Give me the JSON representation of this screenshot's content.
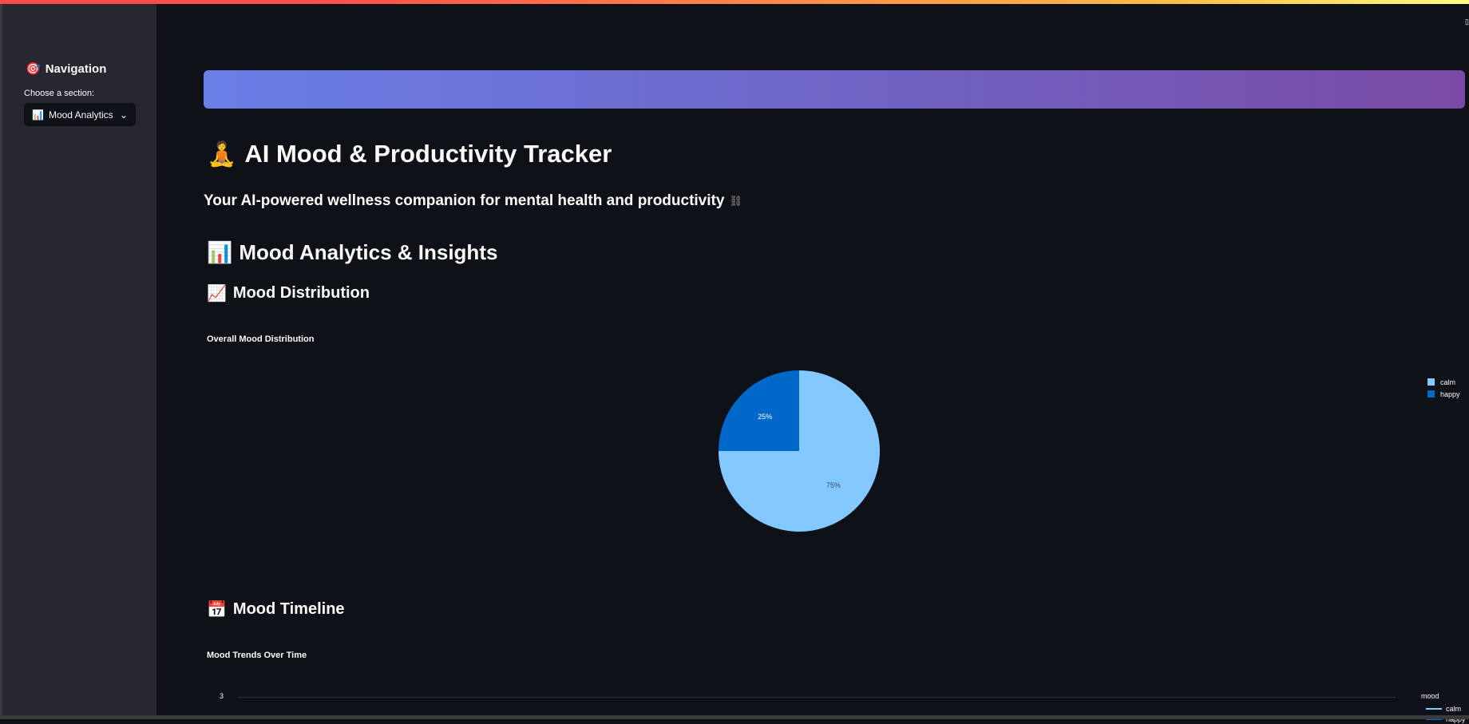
{
  "sidebar": {
    "title": "Navigation",
    "title_icon": "target-icon",
    "choose_label": "Choose a section:",
    "selected": "Mood Analytics",
    "selected_icon": "bar-chart-icon"
  },
  "header": {
    "title": "AI Mood & Productivity Tracker",
    "title_icon": "meditation-icon",
    "subtitle": "Your AI-powered wellness companion for mental health and productivity"
  },
  "section": {
    "title": "Mood Analytics & Insights",
    "distribution_heading": "Mood Distribution",
    "timeline_heading": "Mood Timeline"
  },
  "colors": {
    "accent_gradient_start": "#667eea",
    "accent_gradient_end": "#764ba2",
    "calm": "#83c9ff",
    "happy": "#0068c9"
  },
  "chart_data": [
    {
      "type": "pie",
      "title": "Overall Mood Distribution",
      "labels": [
        "calm",
        "happy"
      ],
      "values": [
        75,
        25
      ],
      "value_labels": [
        "75%",
        "25%"
      ],
      "legend": "top-right"
    },
    {
      "type": "line",
      "title": "Mood Trends Over Time",
      "y_tick_visible": "3",
      "legend_title": "mood",
      "series": [
        {
          "name": "calm"
        },
        {
          "name": "happy"
        }
      ]
    }
  ]
}
